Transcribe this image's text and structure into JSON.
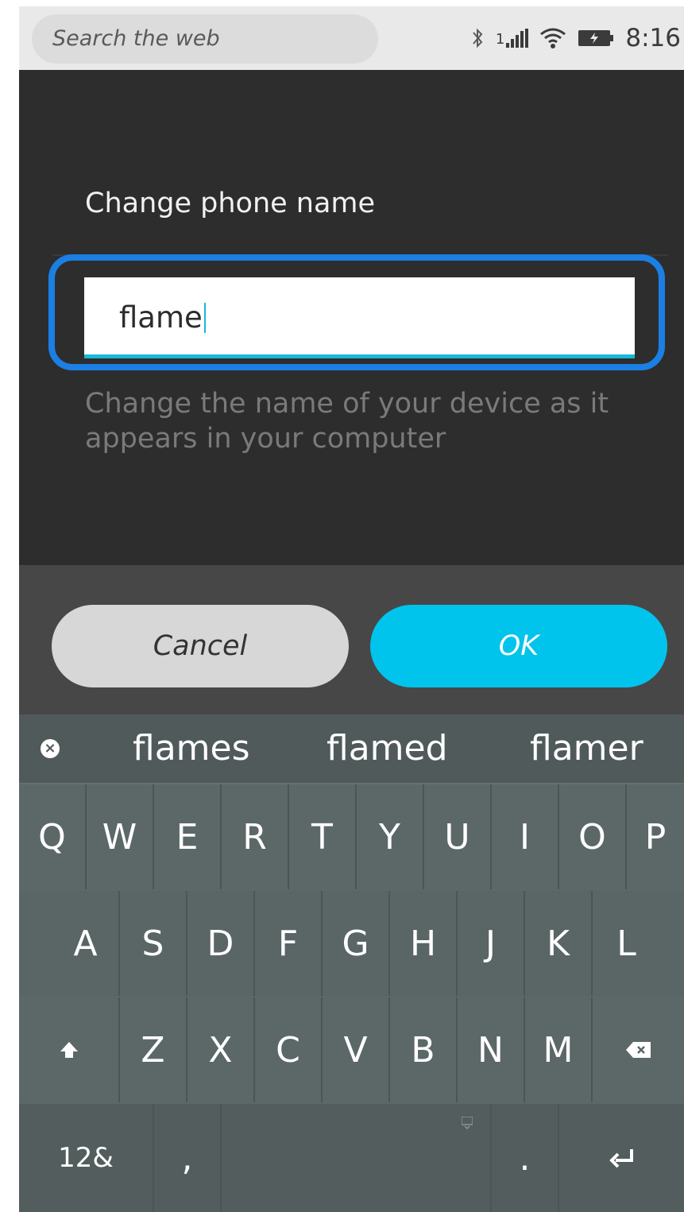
{
  "status_bar": {
    "search_placeholder": "Search the web",
    "signal_label": "1",
    "time": "8:16"
  },
  "dialog": {
    "title": "Change phone name",
    "field_value": "flame",
    "help_text": "Change the name of your device as it appears in your computer"
  },
  "buttons": {
    "cancel_label": "Cancel",
    "ok_label": "OK"
  },
  "keyboard": {
    "suggestions": [
      "flames",
      "flamed",
      "flamer"
    ],
    "row1": [
      "Q",
      "W",
      "E",
      "R",
      "T",
      "Y",
      "U",
      "I",
      "O",
      "P"
    ],
    "row2": [
      "A",
      "S",
      "D",
      "F",
      "G",
      "H",
      "J",
      "K",
      "L"
    ],
    "row3": [
      "Z",
      "X",
      "C",
      "V",
      "B",
      "N",
      "M"
    ],
    "row4": {
      "symbols_label": "12&",
      "comma_label": ",",
      "period_label": "."
    }
  },
  "colors": {
    "accent": "#00c4ec",
    "focus_highlight": "#1b7fe4"
  }
}
